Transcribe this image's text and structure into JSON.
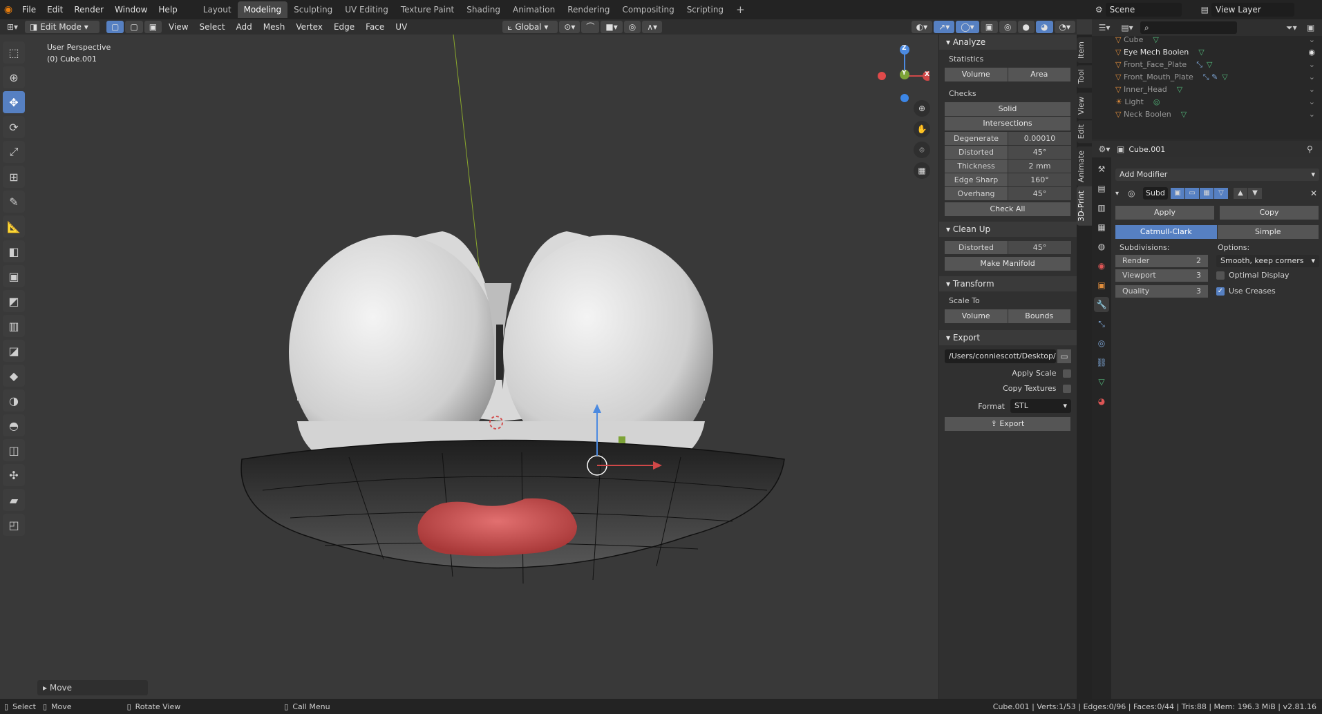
{
  "topbar": {
    "menus": [
      "File",
      "Edit",
      "Render",
      "Window",
      "Help"
    ],
    "workspaces": [
      "Layout",
      "Modeling",
      "Sculpting",
      "UV Editing",
      "Texture Paint",
      "Shading",
      "Animation",
      "Rendering",
      "Compositing",
      "Scripting"
    ],
    "active_workspace": "Modeling",
    "add_tab": "+",
    "scene": "Scene",
    "view_layer": "View Layer"
  },
  "viewport_header": {
    "mode": "Edit Mode",
    "menus": [
      "View",
      "Select",
      "Add",
      "Mesh",
      "Vertex",
      "Edge",
      "Face",
      "UV"
    ],
    "orientation": "Global"
  },
  "viewport": {
    "perspective": "User Perspective",
    "object": "(0) Cube.001",
    "last_op": "Move"
  },
  "gizmo": {
    "z": "Z",
    "x": "X",
    "y": "Y"
  },
  "npanel": {
    "analyze_title": "Analyze",
    "statistics": "Statistics",
    "stat_buttons": [
      "Volume",
      "Area"
    ],
    "checks": "Checks",
    "solid": "Solid",
    "intersections": "Intersections",
    "check_rows": [
      {
        "k": "Degenerate",
        "v": "0.00010"
      },
      {
        "k": "Distorted",
        "v": "45°"
      },
      {
        "k": "Thickness",
        "v": "2 mm"
      },
      {
        "k": "Edge Sharp",
        "v": "160°"
      },
      {
        "k": "Overhang",
        "v": "45°"
      }
    ],
    "check_all": "Check All",
    "cleanup_title": "Clean Up",
    "cleanup_distorted": {
      "k": "Distorted",
      "v": "45°"
    },
    "make_manifold": "Make Manifold",
    "transform_title": "Transform",
    "scale_to": "Scale To",
    "scale_buttons": [
      "Volume",
      "Bounds"
    ],
    "export_title": "Export",
    "export_path": "/Users/conniescott/Desktop/",
    "apply_scale": "Apply Scale",
    "copy_textures": "Copy Textures",
    "format_label": "Format",
    "format_value": "STL",
    "export_button": "Export"
  },
  "vtabs": [
    "Item",
    "Tool",
    "View",
    "Edit",
    "Animate",
    "3D-Print"
  ],
  "outliner": {
    "items": [
      {
        "name": "Cube",
        "active": false
      },
      {
        "name": "Eye Mech Boolen",
        "active": true
      },
      {
        "name": "Front_Face_Plate",
        "active": false
      },
      {
        "name": "Front_Mouth_Plate",
        "active": false
      },
      {
        "name": "Inner_Head",
        "active": false
      },
      {
        "name": "Light",
        "active": false
      },
      {
        "name": "Neck Boolen",
        "active": false
      }
    ]
  },
  "properties": {
    "object_name": "Cube.001",
    "add_modifier": "Add Modifier",
    "modifier_name": "Subd",
    "apply": "Apply",
    "copy": "Copy",
    "catmull": "Catmull-Clark",
    "simple": "Simple",
    "subdivisions": "Subdivisions:",
    "options": "Options:",
    "render_label": "Render",
    "render_value": "2",
    "viewport_label": "Viewport",
    "viewport_value": "3",
    "quality_label": "Quality",
    "quality_value": "3",
    "uv_smooth": "Smooth, keep corners",
    "optimal_display": "Optimal Display",
    "use_creases": "Use Creases"
  },
  "statusbar": {
    "select": "Select",
    "move": "Move",
    "rotate": "Rotate View",
    "call_menu": "Call Menu",
    "stats": "Cube.001 | Verts:1/53 | Edges:0/96 | Faces:0/44 | Tris:88 | Mem: 196.3 MiB | v2.81.16"
  }
}
